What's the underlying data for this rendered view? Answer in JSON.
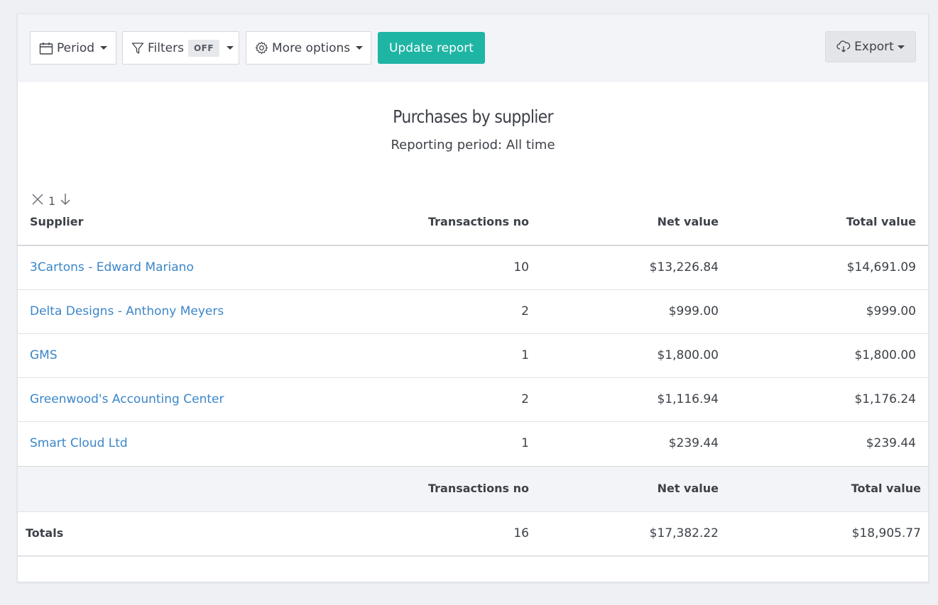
{
  "toolbar": {
    "period_label": "Period",
    "filters_label": "Filters",
    "filters_state": "OFF",
    "more_options_label": "More options",
    "update_label": "Update report",
    "export_label": "Export"
  },
  "report": {
    "title": "Purchases by supplier",
    "subtitle": "Reporting period: All time",
    "sort_indicator": "1"
  },
  "table": {
    "headers": [
      "Supplier",
      "Transactions no",
      "Net value",
      "Total value"
    ],
    "rows": [
      {
        "supplier": "3Cartons - Edward Mariano",
        "transactions": "10",
        "net": "$13,226.84",
        "total": "$14,691.09"
      },
      {
        "supplier": "Delta Designs - Anthony Meyers",
        "transactions": "2",
        "net": "$999.00",
        "total": "$999.00"
      },
      {
        "supplier": "GMS",
        "transactions": "1",
        "net": "$1,800.00",
        "total": "$1,800.00"
      },
      {
        "supplier": "Greenwood's Accounting Center",
        "transactions": "2",
        "net": "$1,116.94",
        "total": "$1,176.24"
      },
      {
        "supplier": "Smart Cloud Ltd",
        "transactions": "1",
        "net": "$239.44",
        "total": "$239.44"
      }
    ],
    "footer_headers": [
      "Transactions no",
      "Net value",
      "Total value"
    ],
    "totals": {
      "label": "Totals",
      "transactions": "16",
      "net": "$17,382.22",
      "total": "$18,905.77"
    }
  },
  "colors": {
    "accent": "#1fb5a4",
    "link": "#3b86c8",
    "background": "#eef0f4"
  },
  "icons": [
    "calendar-icon",
    "filter-icon",
    "gear-icon",
    "cloud-download-icon",
    "close-icon",
    "arrow-down-icon",
    "caret-down-icon"
  ]
}
